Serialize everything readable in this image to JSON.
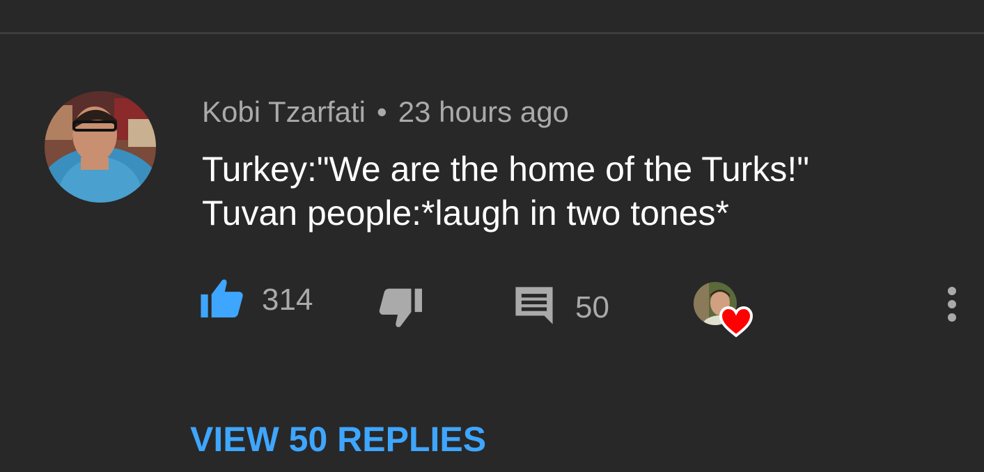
{
  "comment": {
    "author": "Kobi Tzarfati",
    "separator": "•",
    "timestamp": "23 hours ago",
    "text_lines": [
      "Turkey:\"We are the home of the Turks!\"",
      "Tuvan people:*laugh in two tones*"
    ]
  },
  "actions": {
    "like_count": "314",
    "reply_count": "50",
    "like_icon": "thumbs-up-icon",
    "dislike_icon": "thumbs-down-icon",
    "reply_icon": "comment-icon",
    "hearted_icon": "heart-icon",
    "more_icon": "more-vertical-icon"
  },
  "view_replies_label": "VIEW 50 REPLIES",
  "colors": {
    "background": "#282828",
    "accent_blue": "#3ea6ff",
    "like_active": "#3ea6ff",
    "heart_red": "#ff0000",
    "secondary_text": "#aaaaaa",
    "primary_text": "#ffffff"
  }
}
